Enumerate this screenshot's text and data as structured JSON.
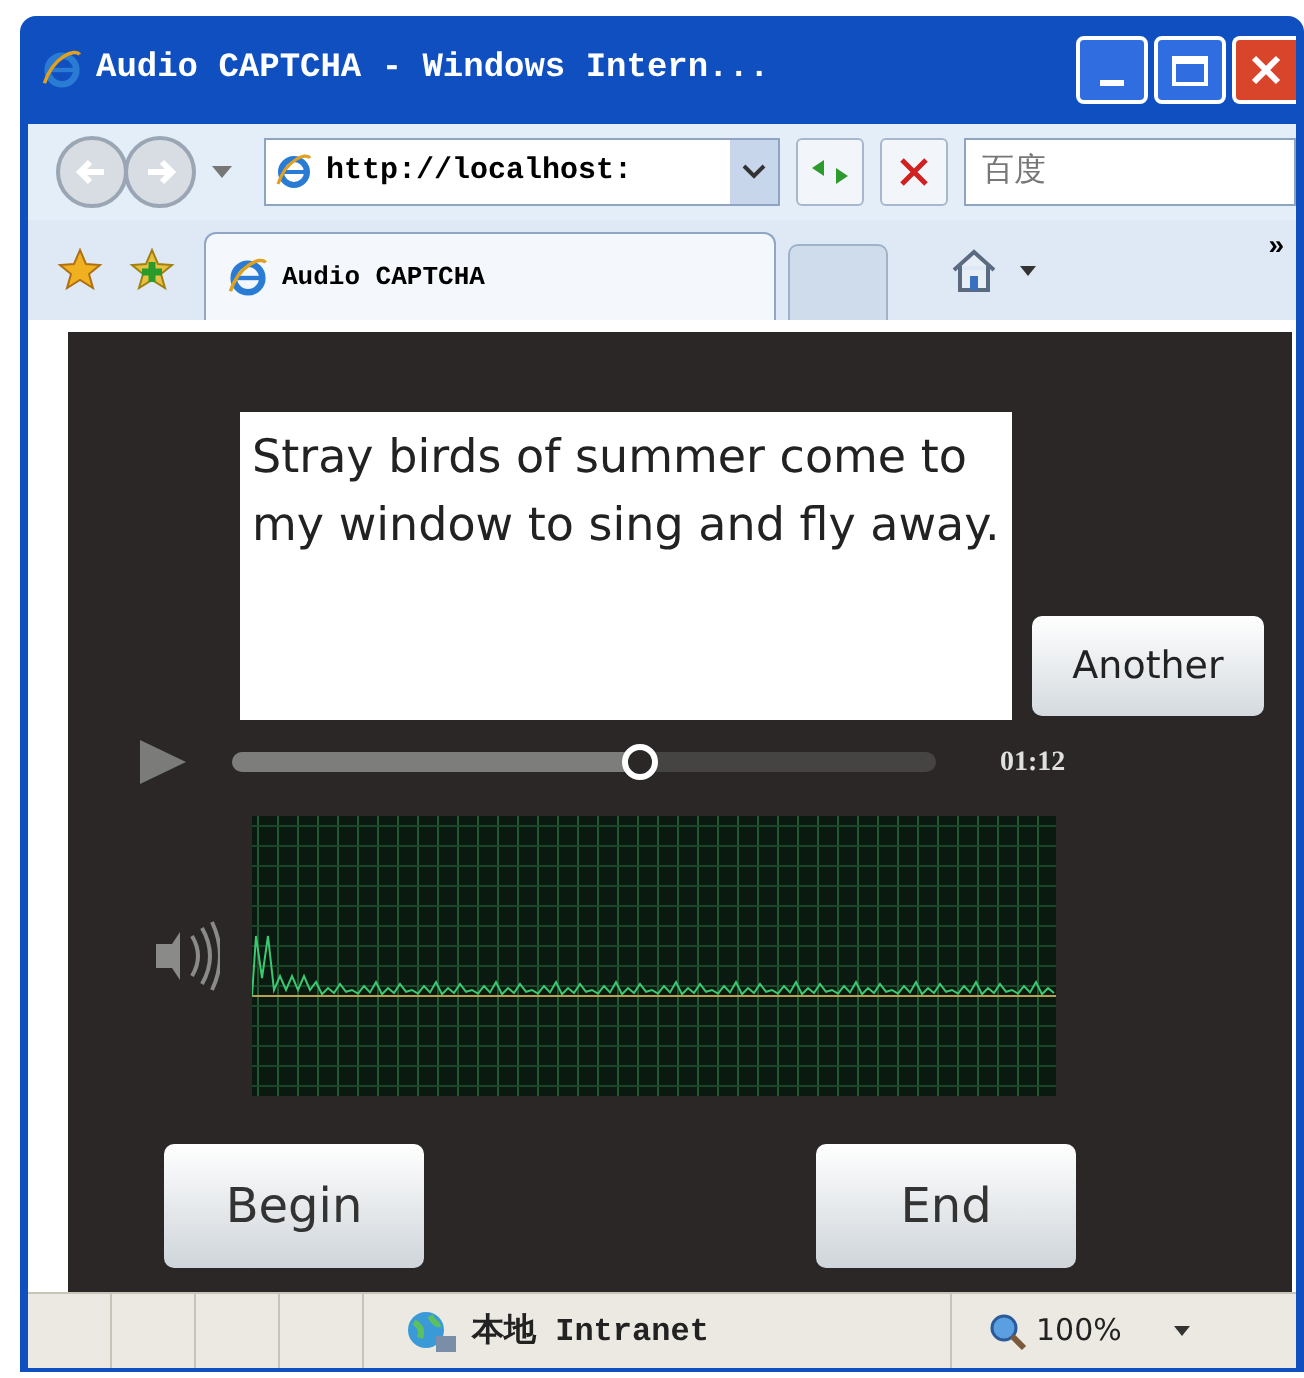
{
  "window": {
    "title": "Audio CAPTCHA - Windows Intern..."
  },
  "address_bar": {
    "url": "http://localhost:"
  },
  "search": {
    "placeholder": "百度"
  },
  "tabs": [
    {
      "label": "Audio CAPTCHA",
      "selected": true
    }
  ],
  "toolbar": {
    "overflow": "»"
  },
  "captcha": {
    "text": "Stray birds of summer come to my window to sing and fly away.",
    "another_button": "Another"
  },
  "player": {
    "level": 0.58,
    "time": "01:12"
  },
  "buttons": [
    {
      "label": "Begin"
    },
    {
      "label": "End"
    }
  ],
  "status_bar": {
    "zone": "本地 Intranet",
    "zoom": "100%"
  }
}
